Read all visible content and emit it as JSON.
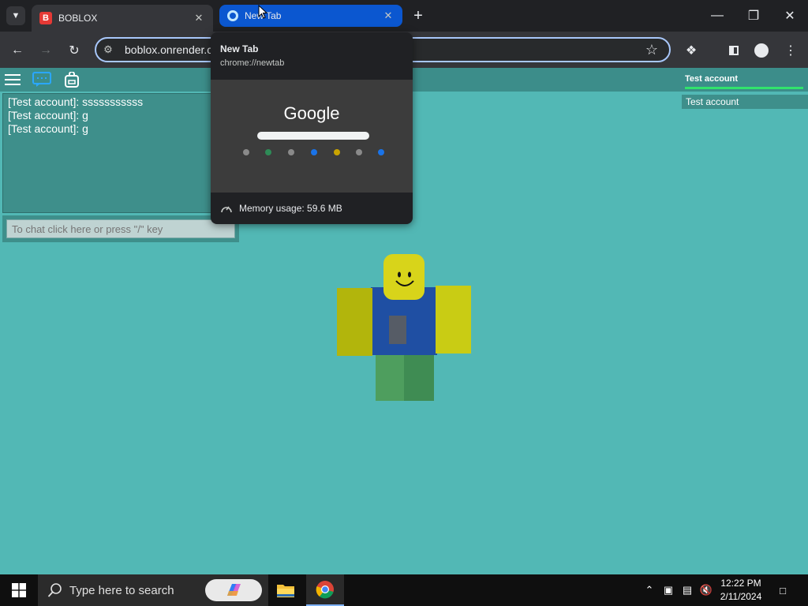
{
  "browser": {
    "tabs": [
      {
        "title": "BOBLOX",
        "favicon": "boblox-logo-icon",
        "active": false
      },
      {
        "title": "New Tab",
        "favicon": "chrome-icon",
        "active": true
      }
    ],
    "address": "boblox.onrender.c",
    "hover_card": {
      "title": "New Tab",
      "url": "chrome://newtab",
      "preview_logo": "Google",
      "memory": "Memory usage: 59.6 MB"
    },
    "accent_color": "#0b57d0"
  },
  "game": {
    "chat": {
      "messages": [
        "[Test account]: sssssssssss",
        "[Test account]: g",
        "[Test account]: g"
      ],
      "input_placeholder": "To chat click here or press \"/\" key"
    },
    "leaderboard": {
      "header": "Test account",
      "players": [
        "Test account"
      ]
    },
    "background_color": "#52b8b5"
  },
  "taskbar": {
    "search_placeholder": "Type here to search",
    "time": "12:22 PM",
    "date": "2/11/2024"
  }
}
